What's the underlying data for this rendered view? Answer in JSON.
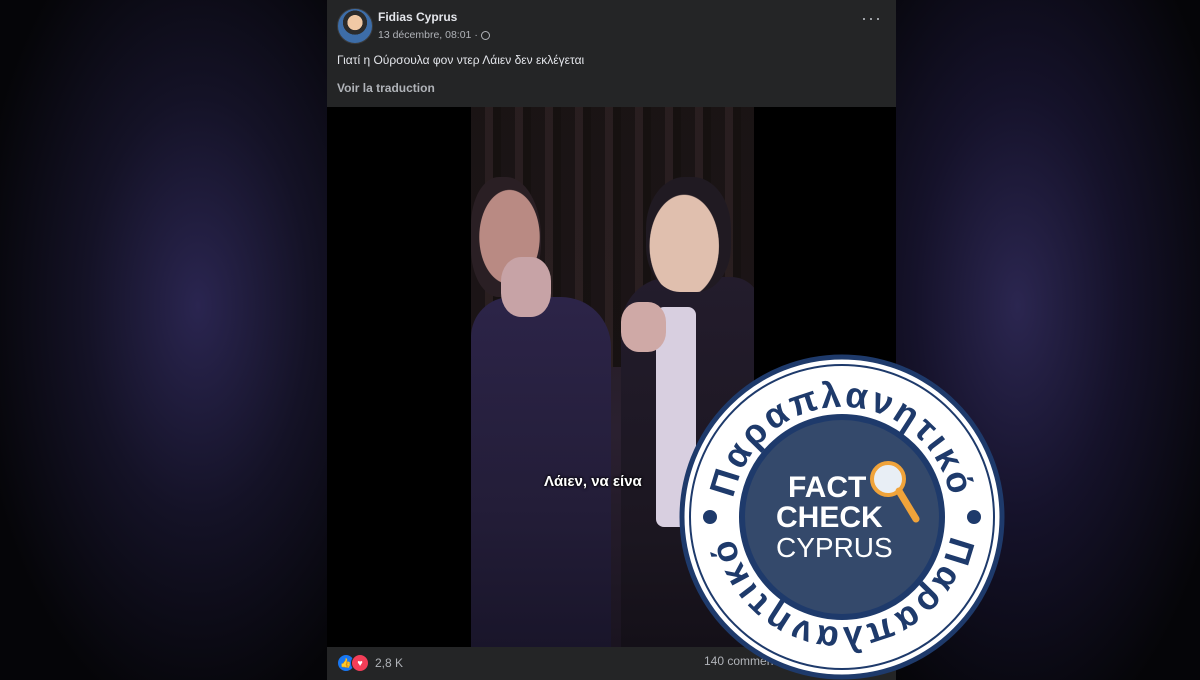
{
  "post": {
    "author": "Fidias Cyprus",
    "date": "13 décembre, 08:01 ·",
    "text": "Γιατί η Ούρσουλα φον ντερ Λάιεν δεν εκλέγεται",
    "translate_label": "Voir la traduction",
    "more_label": "···",
    "video": {
      "subtitle": "Λάιεν, να είνα"
    },
    "reactions": {
      "count": "2,8 K",
      "icons": [
        "like-icon",
        "love-icon"
      ]
    },
    "comments": "140 commen"
  },
  "stamp": {
    "ring_text_top": "Παραπλανητικό",
    "ring_text_bottom": "Παραπλανητικό",
    "line1": "FACT",
    "line2": "CHECK",
    "line3": "CYPRUS",
    "colors": {
      "ring": "#ffffff",
      "border": "#1e3a6b",
      "center": "#34496b",
      "accent": "#f0a33a"
    }
  }
}
